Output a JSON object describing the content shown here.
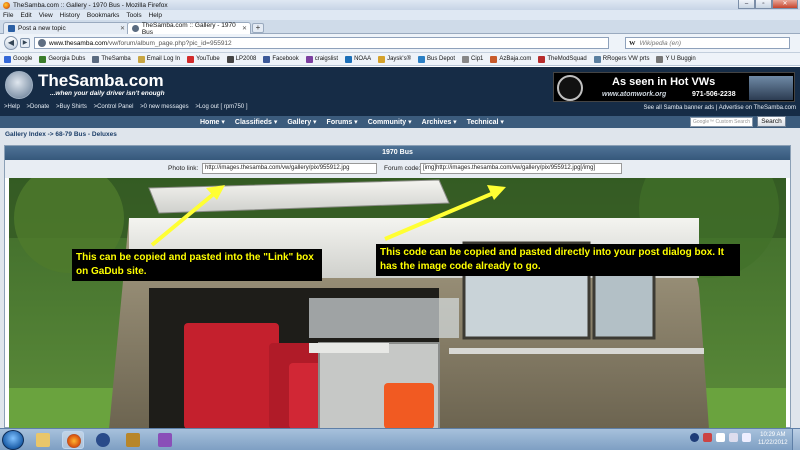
{
  "browser": {
    "window_title": "TheSamba.com :: Gallery - 1970 Bus - Mozilla Firefox",
    "menu": [
      "File",
      "Edit",
      "View",
      "History",
      "Bookmarks",
      "Tools",
      "Help"
    ],
    "tabs": [
      {
        "label": "Post a new topic"
      },
      {
        "label": "TheSamba.com :: Gallery - 1970 Bus"
      }
    ],
    "url_domain": "www.thesamba.com",
    "url_path": "/vw/forum/album_page.php?pic_id=955912",
    "search_placeholder": "Wikipedia (en)",
    "search_engine_icon": "W",
    "bookmarks": [
      {
        "label": "Google",
        "color": "#3367d6"
      },
      {
        "label": "Georgia Dubs",
        "color": "#3a7d2a"
      },
      {
        "label": "TheSamba",
        "color": "#5a6b80"
      },
      {
        "label": "Email Log In",
        "color": "#c8a642"
      },
      {
        "label": "YouTube",
        "color": "#d22b2b"
      },
      {
        "label": "LP2008",
        "color": "#444444"
      },
      {
        "label": "Facebook",
        "color": "#3b5998"
      },
      {
        "label": "craigslist",
        "color": "#7b3fa0"
      },
      {
        "label": "NOAA",
        "color": "#1b6fb8"
      },
      {
        "label": "Jaysk's®",
        "color": "#d5a22a"
      },
      {
        "label": "Bus Depot",
        "color": "#2a7fc4"
      },
      {
        "label": "Cip1",
        "color": "#888888"
      },
      {
        "label": "AzBaja.com",
        "color": "#c85b2a"
      },
      {
        "label": "TheModSquad",
        "color": "#b72c2c"
      },
      {
        "label": "RRogers VW prts",
        "color": "#5a7fa0"
      },
      {
        "label": "Y U Buggin",
        "color": "#777777"
      }
    ]
  },
  "site": {
    "logo": "TheSamba.com",
    "tagline": "...when your daily driver isn't enough",
    "banner": {
      "line1": "As seen in Hot VWs",
      "url": "www.atomwork.org",
      "phone": "971-506-2238"
    },
    "user_links": [
      ">Help",
      ">Donate",
      ">Buy Shirts",
      ">Control Panel",
      ">0 new messages",
      ">Log out [ rpm750 ]"
    ],
    "ad_links": "See all Samba banner ads | Advertise on TheSamba.com",
    "nav_items": [
      "Home ▾",
      "Classifieds ▾",
      "Gallery ▾",
      "Forums ▾",
      "Community ▾",
      "Archives ▾",
      "Technical ▾"
    ],
    "search_placeholder": "Google™ Custom Search",
    "search_button": "Search",
    "breadcrumb": "Gallery Index -> 68-79 Bus - Deluxes",
    "panel_title": "1970 Bus",
    "photo_link_label": "Photo link:",
    "photo_link_value": "http://images.thesamba.com/vw/gallery/pix/955912.jpg",
    "forum_code_label": "Forum code:",
    "forum_code_value": "[img]http://images.thesamba.com/vw/gallery/pix/955912.jpg[/img]"
  },
  "annotations": {
    "left_note": "This can be copied and pasted into the \"Link\" box on GaDub site.",
    "right_note": "This code can be copied and pasted directly into your post dialog box. It has the image code already to go.",
    "arrow_color": "#ffff33",
    "note_text_color": "#ffff00"
  },
  "taskbar": {
    "time": "10:29 AM",
    "date": "11/22/2012"
  }
}
